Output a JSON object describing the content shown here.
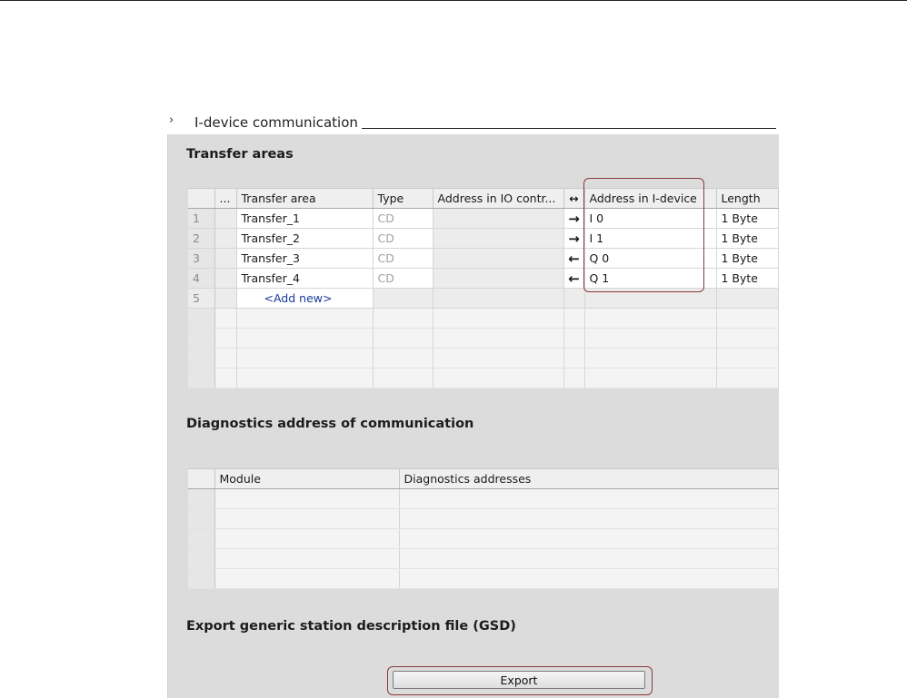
{
  "section": {
    "title": "I-device communication",
    "chevron_icon": "chevron-right-icon"
  },
  "transfer_areas": {
    "heading": "Transfer areas",
    "columns": [
      "...",
      "Transfer area",
      "Type",
      "Address in IO contr...",
      "↔",
      "Address in I-device",
      "Length"
    ],
    "rows": [
      {
        "num": "1",
        "name": "Transfer_1",
        "type": "CD",
        "io_addr": "",
        "direction": "→",
        "idevice_addr": "I 0",
        "length": "1 Byte"
      },
      {
        "num": "2",
        "name": "Transfer_2",
        "type": "CD",
        "io_addr": "",
        "direction": "→",
        "idevice_addr": "I 1",
        "length": "1 Byte"
      },
      {
        "num": "3",
        "name": "Transfer_3",
        "type": "CD",
        "io_addr": "",
        "direction": "←",
        "idevice_addr": "Q 0",
        "length": "1 Byte"
      },
      {
        "num": "4",
        "name": "Transfer_4",
        "type": "CD",
        "io_addr": "",
        "direction": "←",
        "idevice_addr": "Q 1",
        "length": "1 Byte"
      }
    ],
    "add_row": {
      "num": "5",
      "label": "<Add new>"
    }
  },
  "diagnostics": {
    "heading": "Diagnostics address of communication",
    "columns": [
      "Module",
      "Diagnostics addresses"
    ]
  },
  "gsd": {
    "heading": "Export generic station description file (GSD)",
    "export_label": "Export"
  },
  "colors": {
    "panel": "#dcdcdc",
    "highlight": "#8b3a3a",
    "add_new_link": "#1a3b9c"
  }
}
